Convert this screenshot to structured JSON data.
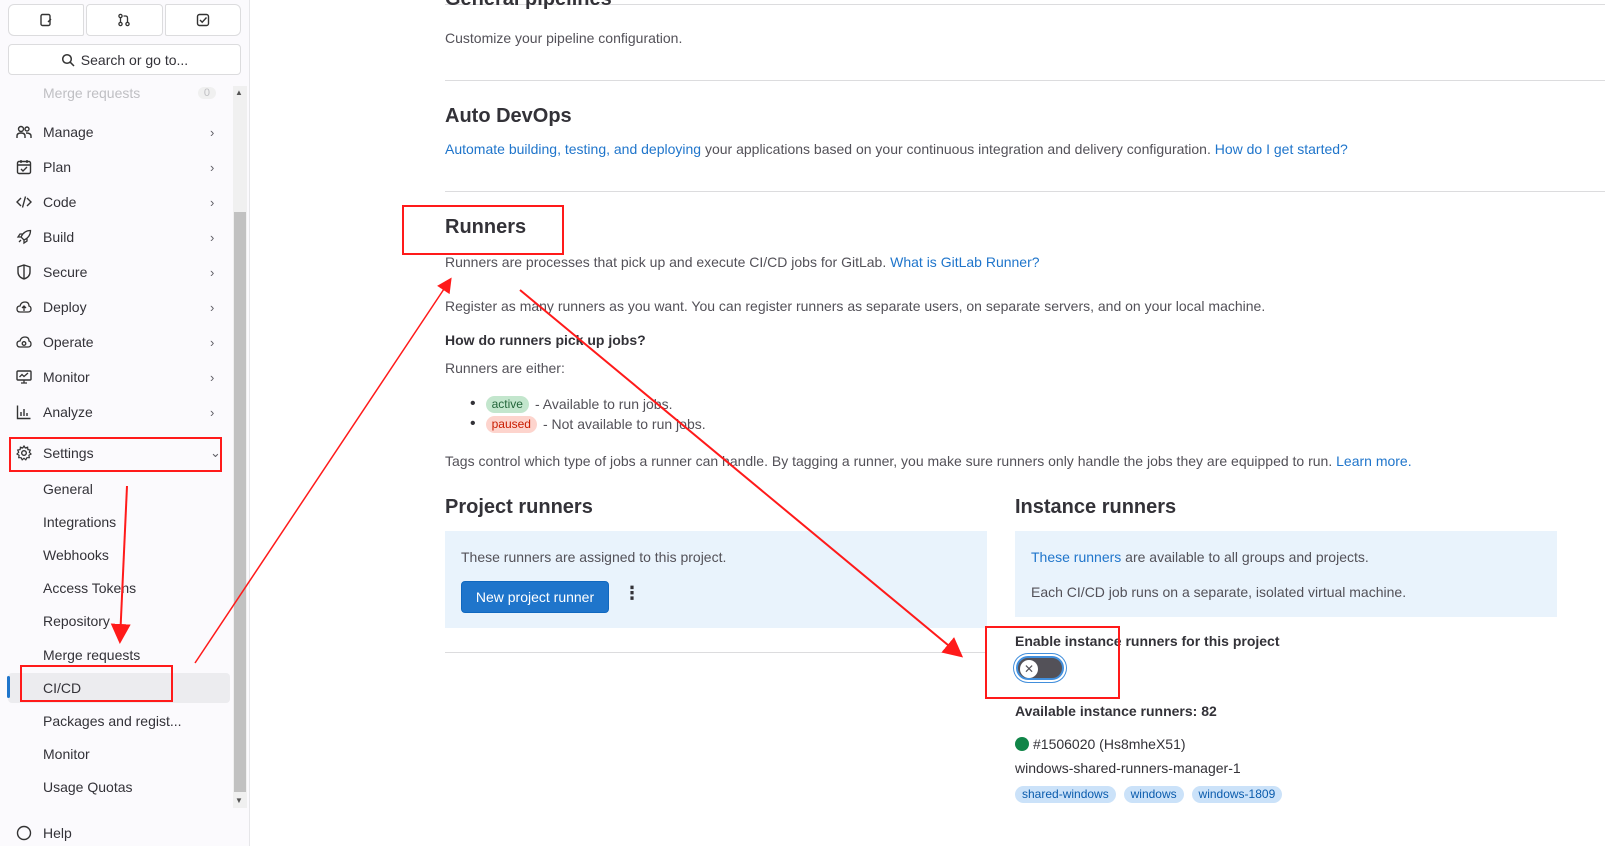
{
  "sidebar": {
    "search_label": "Search or go to...",
    "partial_item": {
      "label": "Merge requests",
      "count": "0"
    },
    "items": [
      {
        "label": "Manage",
        "icon": "users-icon"
      },
      {
        "label": "Plan",
        "icon": "calendar-icon"
      },
      {
        "label": "Code",
        "icon": "code-icon"
      },
      {
        "label": "Build",
        "icon": "rocket-icon"
      },
      {
        "label": "Secure",
        "icon": "shield-icon"
      },
      {
        "label": "Deploy",
        "icon": "cloud-icon"
      },
      {
        "label": "Operate",
        "icon": "cloud-gear-icon"
      },
      {
        "label": "Monitor",
        "icon": "monitor-icon"
      },
      {
        "label": "Analyze",
        "icon": "chart-icon"
      },
      {
        "label": "Settings",
        "icon": "gear-icon"
      }
    ],
    "settings_sub": [
      "General",
      "Integrations",
      "Webhooks",
      "Access Tokens",
      "Repository",
      "Merge requests",
      "CI/CD",
      "Packages and regist...",
      "Monitor",
      "Usage Quotas"
    ],
    "help_label": "Help"
  },
  "general_pipelines": {
    "title": "General pipelines",
    "desc": "Customize your pipeline configuration."
  },
  "auto_devops": {
    "title": "Auto DevOps",
    "link1": "Automate building, testing, and deploying",
    "text": " your applications based on your continuous integration and delivery configuration. ",
    "link2": "How do I get started?"
  },
  "runners": {
    "title": "Runners",
    "intro": "Runners are processes that pick up and execute CI/CD jobs for GitLab. ",
    "intro_link": "What is GitLab Runner?",
    "register": "Register as many runners as you want. You can register runners as separate users, on separate servers, and on your local machine.",
    "how_title": "How do runners pick up jobs?",
    "either": "Runners are either:",
    "active_badge": "active",
    "active_text": "- Available to run jobs.",
    "paused_badge": "paused",
    "paused_text": "- Not available to run jobs.",
    "tags_text": "Tags control which type of jobs a runner can handle. By tagging a runner, you make sure runners only handle the jobs they are equipped to run. ",
    "tags_link": "Learn more."
  },
  "project_runners": {
    "title": "Project runners",
    "desc": "These runners are assigned to this project.",
    "button": "New project runner"
  },
  "instance_runners": {
    "title": "Instance runners",
    "desc_link": "These runners",
    "desc_text": " are available to all groups and projects.",
    "desc2": "Each CI/CD job runs on a separate, isolated virtual machine.",
    "toggle_label": "Enable instance runners for this project",
    "toggle_on": false,
    "available": "Available instance runners: 82",
    "runner_id": "#1506020 (Hs8mheX51)",
    "runner_name": "windows-shared-runners-manager-1",
    "tags": [
      "shared-windows",
      "windows",
      "windows-1809"
    ]
  },
  "colors": {
    "accent": "#1f75cb",
    "annotation": "#ff1a1a",
    "status_online": "#108548"
  }
}
